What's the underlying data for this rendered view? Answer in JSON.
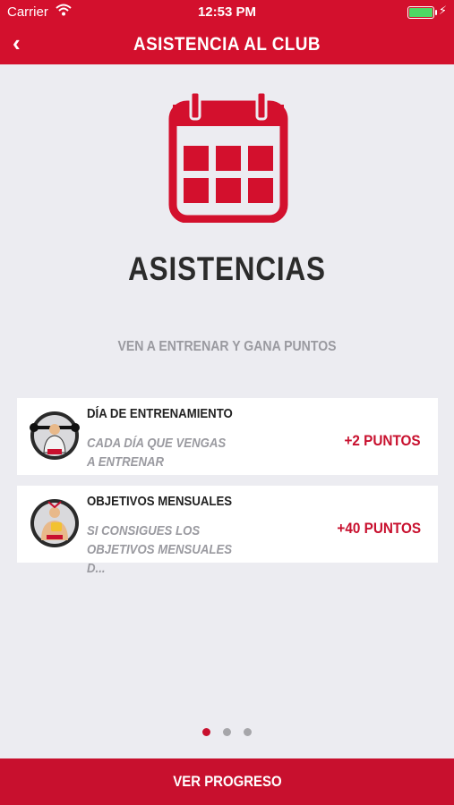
{
  "status_bar": {
    "carrier": "Carrier",
    "time": "12:53 PM",
    "battery_color": "#4cd964"
  },
  "nav": {
    "back_icon": "chevron-left-icon",
    "back_glyph": "‹",
    "title": "ASISTENCIA AL CLUB"
  },
  "hero": {
    "icon": "calendar-icon",
    "heading": "ASISTENCIAS",
    "subtitle": "VEN A ENTRENAR Y GANA PUNTOS"
  },
  "cards": [
    {
      "title": "DÍA DE ENTRENAMIENTO",
      "description": "CADA DÍA QUE VENGAS A ENTRENAR",
      "points": "+2 PUNTOS",
      "icon": "weightlifter-icon"
    },
    {
      "title": "OBJETIVOS MENSUALES",
      "description": "SI CONSIGUES LOS OBJETIVOS MENSUALES D...",
      "points": "+40 PUNTOS",
      "icon": "trophy-athlete-icon"
    }
  ],
  "pagination": {
    "pages": 3,
    "active": 1
  },
  "footer": {
    "button_label": "VER PROGRESO"
  },
  "colors": {
    "brand_red": "#d3102d",
    "accent_red": "#c8102e",
    "background": "#ececf1",
    "muted_text": "#9a9aa0"
  }
}
